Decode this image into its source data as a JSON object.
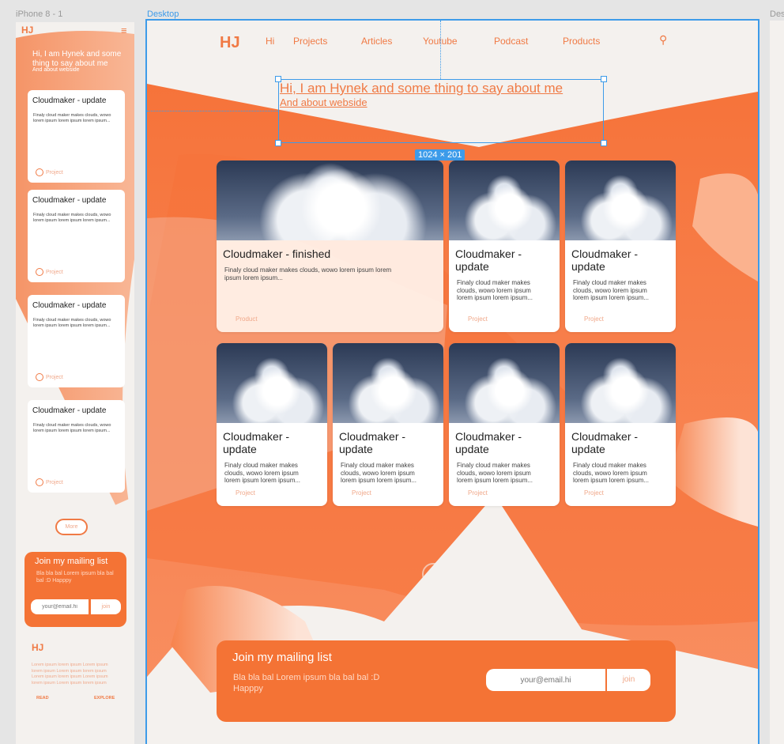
{
  "canvas": {
    "frames": [
      "iPhone 8 - 1",
      "Desktop",
      "Des"
    ],
    "selection_size": "1024 × 201"
  },
  "colors": {
    "accent": "#f07a45",
    "selection": "#3d9be9",
    "canvas": "#e5e5e5",
    "frame": "#f4f1ee"
  },
  "logo": "HJ",
  "mobile": {
    "menu_icon": "hamburger-icon",
    "hero_title": "Hi, I am Hynek and some thing to say about me",
    "hero_sub": "And about webside",
    "cards": [
      {
        "title": "Cloudmaker - update",
        "text": "Finaly cloud maker makes clouds, wowo lorem ipsum lorem ipsum lorem ipsum...",
        "tag": "Project"
      },
      {
        "title": "Cloudmaker - update",
        "text": "Finaly cloud maker makes clouds, wowo lorem ipsum lorem ipsum lorem ipsum...",
        "tag": "Project"
      },
      {
        "title": "Cloudmaker - update",
        "text": "Finaly cloud maker makes clouds, wowo lorem ipsum lorem ipsum lorem ipsum...",
        "tag": "Project"
      },
      {
        "title": "Cloudmaker - update",
        "text": "Finaly cloud maker makes clouds, wowo lorem ipsum lorem ipsum lorem ipsum...",
        "tag": "Project"
      }
    ],
    "more": "More",
    "mailing": {
      "title": "Join my mailing list",
      "text": "Bla bla bal Lorem ipsum bla bal bal :D Happpy",
      "placeholder": "your@email.hi",
      "join": "join"
    },
    "footer": {
      "text": "Lorem ipsum lorem ipsum Lorem ipsum lorem ipsum Lorem ipsum lorem ipsum Lorem ipsum lorem ipsum Lorem ipsum lorem ipsum Lorem ipsum lorem ipsum",
      "read": "READ",
      "explore": "EXPLORE"
    }
  },
  "desktop": {
    "nav": [
      "Hi",
      "Projects",
      "Articles",
      "Youtube",
      "Podcast",
      "Products"
    ],
    "search_icon": "search-icon",
    "hero_title": "Hi, I am Hynek and some thing to say about me",
    "hero_sub": "And about webside",
    "cards": [
      {
        "title": "Cloudmaker - finished",
        "text": "Finaly cloud maker makes clouds, wowo lorem ipsum lorem ipsum lorem ipsum...",
        "tag": "Product"
      },
      {
        "title": "Cloudmaker - update",
        "text": "Finaly cloud maker makes clouds, wowo lorem ipsum lorem ipsum lorem ipsum...",
        "tag": "Project"
      },
      {
        "title": "Cloudmaker - update",
        "text": "Finaly cloud maker makes clouds, wowo lorem ipsum lorem ipsum lorem ipsum...",
        "tag": "Project"
      },
      {
        "title": "Cloudmaker - update",
        "text": "Finaly cloud maker makes clouds, wowo lorem ipsum lorem ipsum lorem ipsum...",
        "tag": "Project"
      },
      {
        "title": "Cloudmaker - update",
        "text": "Finaly cloud maker makes clouds, wowo lorem ipsum lorem ipsum lorem ipsum...",
        "tag": "Project"
      },
      {
        "title": "Cloudmaker - update",
        "text": "Finaly cloud maker makes clouds, wowo lorem ipsum lorem ipsum lorem ipsum...",
        "tag": "Project"
      },
      {
        "title": "Cloudmaker - update",
        "text": "Finaly cloud maker makes clouds, wowo lorem ipsum lorem ipsum lorem ipsum...",
        "tag": "Project"
      }
    ],
    "mailing": {
      "title": "Join my mailing list",
      "text": "Bla bla bal Lorem ipsum bla bal bal :D Happpy",
      "placeholder": "your@email.hi",
      "join": "join"
    }
  }
}
